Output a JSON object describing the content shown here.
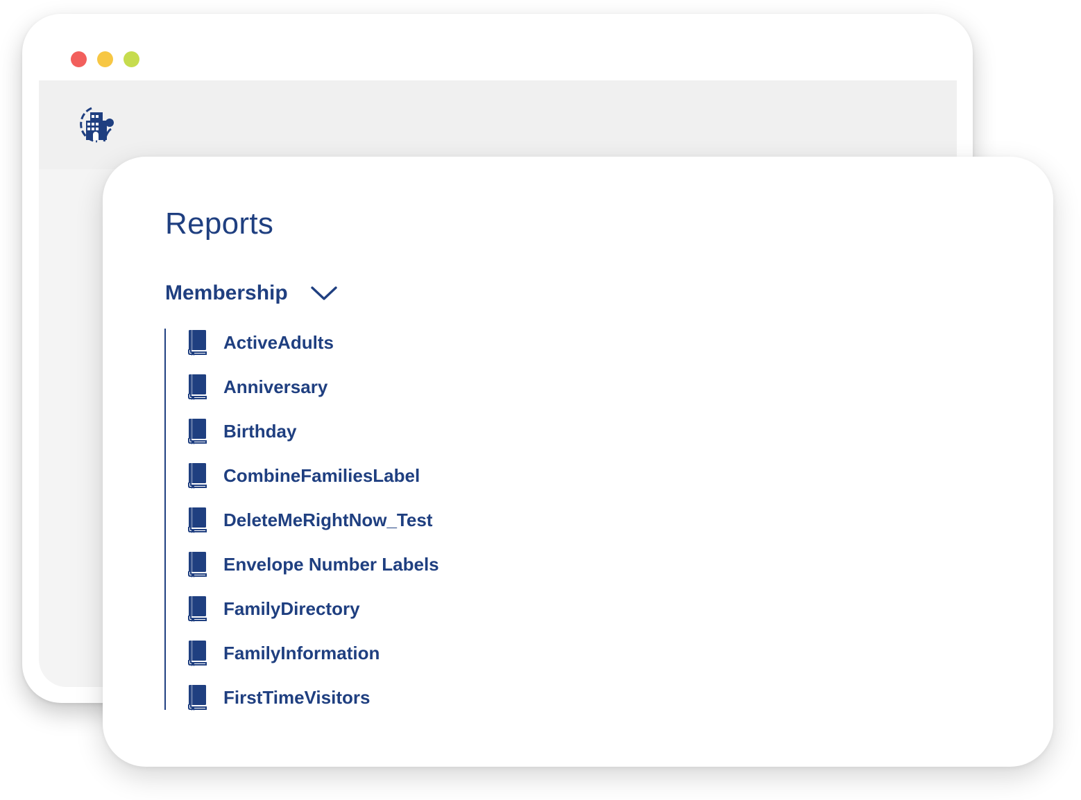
{
  "window": {
    "controls": [
      "close",
      "minimize",
      "maximize"
    ],
    "colors": {
      "close": "#f25f5c",
      "minimize": "#f7c744",
      "maximize": "#c6dc4e"
    }
  },
  "app": {
    "logo_icon": "church-building-icon",
    "accent_color": "#1f3f80"
  },
  "reports": {
    "title": "Reports",
    "section": {
      "label": "Membership",
      "expanded": true,
      "toggle_icon": "chevron-down-icon",
      "item_icon": "book-icon",
      "items": [
        {
          "label": "ActiveAdults"
        },
        {
          "label": "Anniversary"
        },
        {
          "label": "Birthday"
        },
        {
          "label": "CombineFamiliesLabel"
        },
        {
          "label": "DeleteMeRightNow_Test"
        },
        {
          "label": "Envelope Number Labels"
        },
        {
          "label": "FamilyDirectory"
        },
        {
          "label": "FamilyInformation"
        },
        {
          "label": "FirstTimeVisitors"
        }
      ]
    }
  }
}
